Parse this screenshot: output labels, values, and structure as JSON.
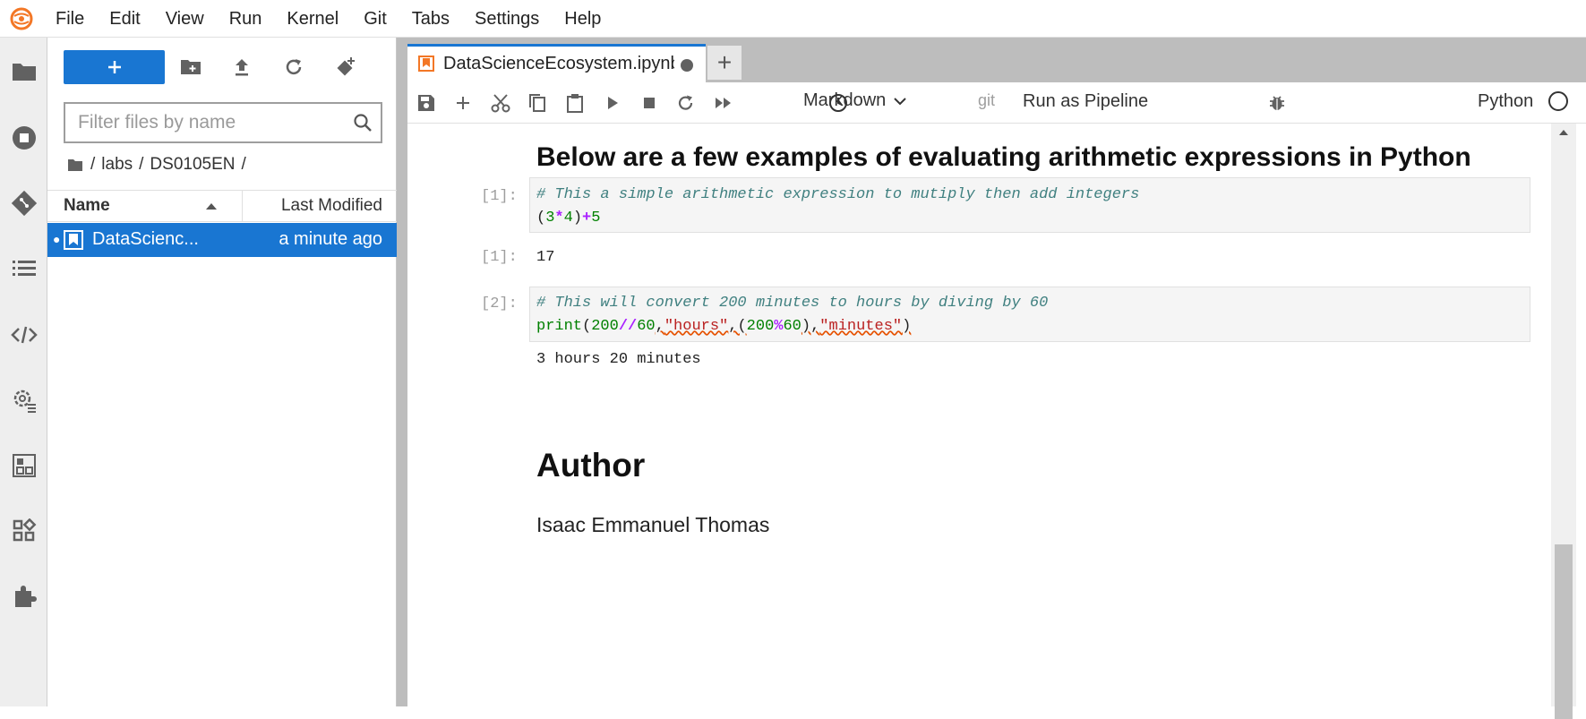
{
  "menubar": {
    "items": [
      "File",
      "Edit",
      "View",
      "Run",
      "Kernel",
      "Git",
      "Tabs",
      "Settings",
      "Help"
    ]
  },
  "filebrowser": {
    "filter_placeholder": "Filter files by name",
    "breadcrumbs": [
      "/",
      "labs",
      "/",
      "DS0105EN",
      "/"
    ],
    "columns": {
      "name": "Name",
      "modified": "Last Modified"
    },
    "files": [
      {
        "name": "DataScienc...",
        "modified": "a minute ago"
      }
    ]
  },
  "tab": {
    "title": "DataScienceEcosystem.ipynb"
  },
  "toolbar": {
    "cell_type": "Markdown",
    "git_label": "git",
    "run_pipeline": "Run as Pipeline",
    "kernel": "Python"
  },
  "notebook": {
    "heading": "Below are a few examples of evaluating arithmetic expressions in Python",
    "cells": [
      {
        "in_prompt": "[1]:",
        "out_prompt": "[1]:",
        "comment": "# This a simple arithmetic expression to mutiply then add integers",
        "output": "17"
      },
      {
        "in_prompt": "[2]:",
        "comment": "# This will convert 200 minutes to hours by diving by 60",
        "output": "3 hours 20 minutes"
      }
    ],
    "author_heading": "Author",
    "author_name": "Isaac Emmanuel Thomas"
  },
  "colors": {
    "accent": "#1976d2",
    "toolbar_icon": "#616161"
  }
}
